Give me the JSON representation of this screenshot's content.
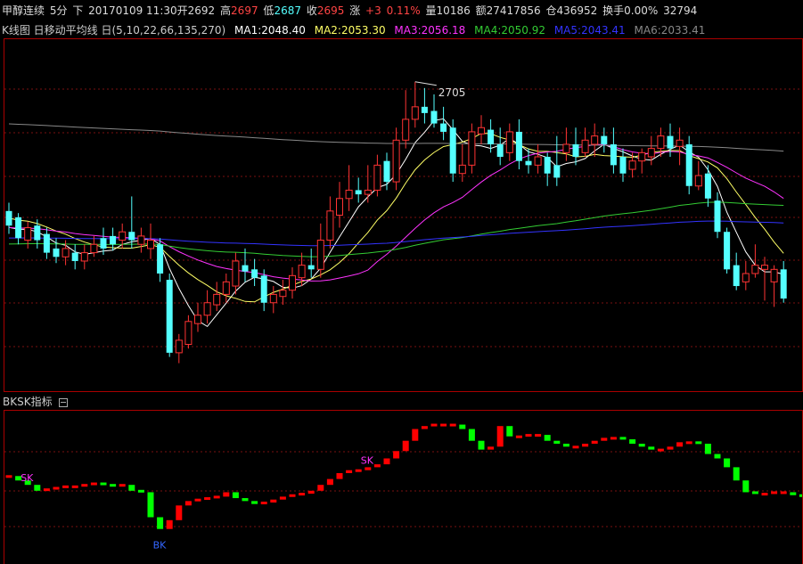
{
  "header": {
    "name": "甲醇连续",
    "period": "5分",
    "direction": "下",
    "datetime": "20170109 11:30",
    "open_label": "开",
    "open": "2692",
    "high_label": "高",
    "high": "2697",
    "low_label": "低",
    "low": "2687",
    "close_label": "收",
    "close": "2695",
    "change_label": "涨",
    "change": "+3",
    "change_pct": "0.11%",
    "volume_label": "量",
    "volume": "10186",
    "amount_label": "额",
    "amount": "27417856",
    "oi_label": "仓",
    "oi": "436952",
    "turnover_label": "换手",
    "turnover": "0.00%",
    "extra": "32794"
  },
  "ma_legend": {
    "title": "K线图 日移动平均线 日(5,10,22,66,135,270)",
    "ma1": "MA1:2048.40",
    "ma2": "MA2:2053.30",
    "ma3": "MA3:2056.18",
    "ma4": "MA4:2050.92",
    "ma5": "MA5:2043.41",
    "ma6": "MA6:2033.41"
  },
  "sub_legend": {
    "title": "BKSK指标",
    "icon": "collapse-icon"
  },
  "colors": {
    "up": "#ff3333",
    "down": "#54ffff",
    "ma1": "#ffffff",
    "ma2": "#ffff66",
    "ma3": "#ff33ff",
    "ma4": "#33cc33",
    "ma5": "#3333ff",
    "ma6": "#888888",
    "bk_up": "#ff0000",
    "bk_down": "#00ff00"
  },
  "chart_data": [
    {
      "type": "candlestick",
      "title": "",
      "ylim": [
        2572,
        2740
      ],
      "annotation": {
        "label": "2705",
        "value": 2705
      },
      "candles": [
        [
          2658,
          2651,
          2662,
          2647
        ],
        [
          2655,
          2645,
          2657,
          2642
        ],
        [
          2644,
          2650,
          2653,
          2640
        ],
        [
          2651,
          2644,
          2654,
          2640
        ],
        [
          2647,
          2638,
          2650,
          2635
        ],
        [
          2640,
          2636,
          2645,
          2633
        ],
        [
          2636,
          2640,
          2644,
          2632
        ],
        [
          2638,
          2634,
          2642,
          2630
        ],
        [
          2634,
          2638,
          2642,
          2630
        ],
        [
          2638,
          2642,
          2646,
          2636
        ],
        [
          2645,
          2640,
          2650,
          2637
        ],
        [
          2646,
          2642,
          2650,
          2639
        ],
        [
          2644,
          2648,
          2652,
          2640
        ],
        [
          2648,
          2644,
          2665,
          2640
        ],
        [
          2642,
          2646,
          2650,
          2638
        ],
        [
          2640,
          2644,
          2652,
          2635
        ],
        [
          2642,
          2628,
          2645,
          2624
        ],
        [
          2625,
          2590,
          2628,
          2588
        ],
        [
          2590,
          2596,
          2599,
          2585
        ],
        [
          2594,
          2605,
          2608,
          2592
        ],
        [
          2604,
          2608,
          2614,
          2600
        ],
        [
          2608,
          2614,
          2620,
          2604
        ],
        [
          2613,
          2618,
          2624,
          2610
        ],
        [
          2618,
          2624,
          2628,
          2614
        ],
        [
          2622,
          2634,
          2638,
          2618
        ],
        [
          2632,
          2629,
          2640,
          2624
        ],
        [
          2630,
          2626,
          2635,
          2622
        ],
        [
          2627,
          2614,
          2630,
          2610
        ],
        [
          2614,
          2618,
          2622,
          2609
        ],
        [
          2617,
          2620,
          2625,
          2613
        ],
        [
          2620,
          2627,
          2631,
          2616
        ],
        [
          2626,
          2632,
          2638,
          2622
        ],
        [
          2632,
          2630,
          2640,
          2626
        ],
        [
          2630,
          2644,
          2652,
          2626
        ],
        [
          2644,
          2658,
          2665,
          2640
        ],
        [
          2656,
          2664,
          2672,
          2650
        ],
        [
          2664,
          2668,
          2680,
          2658
        ],
        [
          2668,
          2666,
          2674,
          2662
        ],
        [
          2666,
          2668,
          2680,
          2662
        ],
        [
          2668,
          2680,
          2685,
          2665
        ],
        [
          2682,
          2672,
          2686,
          2668
        ],
        [
          2672,
          2692,
          2698,
          2668
        ],
        [
          2692,
          2702,
          2716,
          2688
        ],
        [
          2702,
          2708,
          2720,
          2698
        ],
        [
          2708,
          2705,
          2717,
          2700
        ],
        [
          2706,
          2700,
          2714,
          2698
        ],
        [
          2700,
          2696,
          2708,
          2692
        ],
        [
          2698,
          2676,
          2702,
          2672
        ],
        [
          2676,
          2680,
          2690,
          2672
        ],
        [
          2680,
          2696,
          2700,
          2676
        ],
        [
          2695,
          2698,
          2704,
          2690
        ],
        [
          2697,
          2690,
          2702,
          2686
        ],
        [
          2690,
          2684,
          2698,
          2680
        ],
        [
          2686,
          2696,
          2700,
          2682
        ],
        [
          2696,
          2682,
          2702,
          2678
        ],
        [
          2682,
          2680,
          2688,
          2676
        ],
        [
          2680,
          2684,
          2690,
          2676
        ],
        [
          2684,
          2676,
          2686,
          2670
        ],
        [
          2680,
          2674,
          2694,
          2670
        ],
        [
          2686,
          2690,
          2698,
          2682
        ],
        [
          2690,
          2684,
          2698,
          2680
        ],
        [
          2686,
          2692,
          2698,
          2684
        ],
        [
          2690,
          2694,
          2700,
          2684
        ],
        [
          2694,
          2690,
          2698,
          2686
        ],
        [
          2690,
          2680,
          2698,
          2676
        ],
        [
          2684,
          2676,
          2688,
          2672
        ],
        [
          2678,
          2682,
          2686,
          2674
        ],
        [
          2682,
          2686,
          2688,
          2676
        ],
        [
          2684,
          2688,
          2694,
          2680
        ],
        [
          2688,
          2694,
          2698,
          2684
        ],
        [
          2694,
          2688,
          2700,
          2684
        ],
        [
          2689,
          2692,
          2698,
          2680
        ],
        [
          2690,
          2670,
          2694,
          2666
        ],
        [
          2670,
          2675,
          2682,
          2668
        ],
        [
          2676,
          2664,
          2680,
          2660
        ],
        [
          2663,
          2648,
          2667,
          2645
        ],
        [
          2648,
          2630,
          2650,
          2628
        ],
        [
          2632,
          2622,
          2638,
          2620
        ],
        [
          2624,
          2628,
          2634,
          2620
        ],
        [
          2628,
          2632,
          2642,
          2626
        ],
        [
          2630,
          2632,
          2636,
          2615
        ],
        [
          2624,
          2630,
          2632,
          2612
        ],
        [
          2630,
          2616,
          2634,
          2614
        ]
      ]
    },
    {
      "type": "bar",
      "title": "",
      "ylim": [
        0,
        100
      ],
      "signals": [
        {
          "label": "SK",
          "index": 2
        },
        {
          "label": "BK",
          "index": 16
        },
        {
          "label": "SK",
          "index": 38
        }
      ],
      "values": [
        58,
        55,
        52,
        48,
        49,
        50,
        51,
        51,
        52,
        53,
        52,
        51,
        52,
        48,
        47,
        30,
        22,
        28,
        38,
        41,
        42,
        43,
        44,
        47,
        43,
        41,
        39,
        40,
        42,
        44,
        45,
        46,
        48,
        52,
        56,
        60,
        62,
        62,
        64,
        66,
        70,
        75,
        82,
        90,
        92,
        93,
        93,
        93,
        90,
        82,
        76,
        78,
        92,
        85,
        85,
        86,
        86,
        82,
        80,
        78,
        78,
        80,
        82,
        84,
        84,
        83,
        80,
        78,
        76,
        76,
        78,
        81,
        81,
        80,
        73,
        70,
        64,
        55,
        47,
        46,
        46,
        47,
        47,
        45,
        44
      ]
    }
  ]
}
